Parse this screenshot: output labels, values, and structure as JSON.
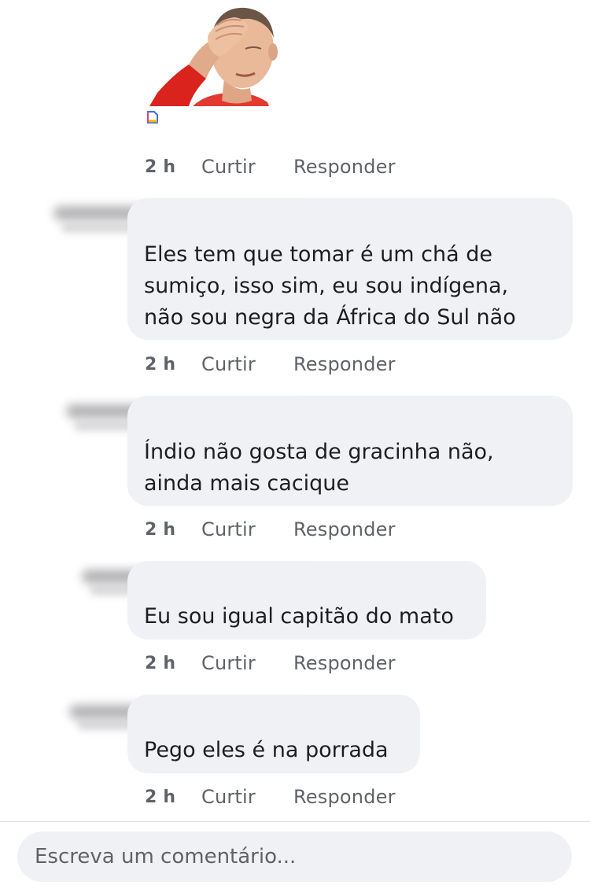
{
  "comments": [
    {
      "type": "sticker",
      "time": "2 h",
      "like_label": "Curtir",
      "reply_label": "Responder"
    },
    {
      "type": "text",
      "text": "Eles tem que tomar é um chá de\nsumiço, isso sim, eu sou indígena,\nnão sou negra da África do Sul não",
      "time": "2 h",
      "like_label": "Curtir",
      "reply_label": "Responder"
    },
    {
      "type": "text",
      "text": "Índio não gosta de gracinha não,\nainda mais cacique",
      "time": "2 h",
      "like_label": "Curtir",
      "reply_label": "Responder"
    },
    {
      "type": "text",
      "text": "Eu sou igual capitão do mato",
      "time": "2 h",
      "like_label": "Curtir",
      "reply_label": "Responder"
    },
    {
      "type": "text",
      "text": "Pego eles é na porrada",
      "time": "2 h",
      "like_label": "Curtir",
      "reply_label": "Responder"
    }
  ],
  "composer": {
    "placeholder": "Escreva um comentário..."
  },
  "colors": {
    "bubble": "#f0f1f5",
    "meta_text": "#5f6368",
    "sticker_sleeve": "#d9231c",
    "skin": "#e9b99a"
  },
  "icons": {
    "sticker_attachment": "file-icon",
    "author_name": "blurred-name"
  }
}
